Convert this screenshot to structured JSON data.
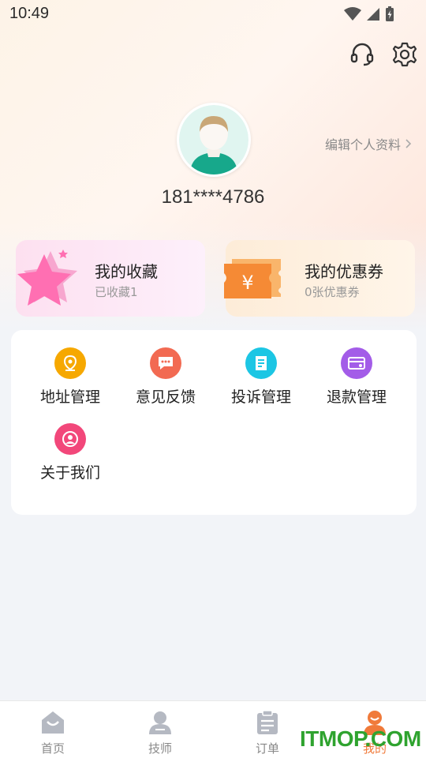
{
  "status_bar": {
    "time": "10:49"
  },
  "profile": {
    "phone": "181****4786",
    "edit_label": "编辑个人资料"
  },
  "cards": {
    "favorites": {
      "title": "我的收藏",
      "subtitle": "已收藏1"
    },
    "coupons": {
      "title": "我的优惠券",
      "subtitle": "0张优惠券"
    }
  },
  "menu": {
    "items": [
      {
        "label": "地址管理",
        "icon": "location-pin-icon",
        "color": "#f6a800"
      },
      {
        "label": "意见反馈",
        "icon": "chat-bubble-icon",
        "color": "#f26a52"
      },
      {
        "label": "投诉管理",
        "icon": "document-icon",
        "color": "#1cc6e4"
      },
      {
        "label": "退款管理",
        "icon": "card-refund-icon",
        "color": "#a35ce8"
      },
      {
        "label": "关于我们",
        "icon": "person-icon",
        "color": "#f2477a"
      }
    ]
  },
  "tabbar": {
    "tabs": [
      {
        "label": "首页",
        "icon": "home-icon"
      },
      {
        "label": "技师",
        "icon": "technician-icon"
      },
      {
        "label": "订单",
        "icon": "clipboard-icon"
      },
      {
        "label": "我的",
        "icon": "user-icon",
        "active": true
      }
    ]
  },
  "watermark": {
    "text": "ITMOP.COM"
  },
  "colors": {
    "accent": "#f07a3a",
    "background": "#f2f4f8"
  }
}
